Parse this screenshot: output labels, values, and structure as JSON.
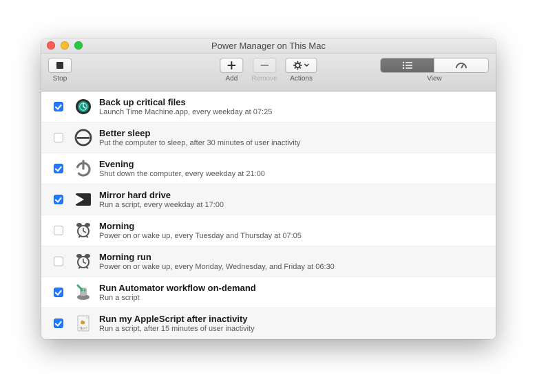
{
  "window": {
    "title": "Power Manager on This Mac"
  },
  "toolbar": {
    "stop": "Stop",
    "add": "Add",
    "remove": "Remove",
    "actions": "Actions",
    "view": "View"
  },
  "events": [
    {
      "checked": true,
      "icon": "timemachine",
      "title": "Back up critical files",
      "subtitle": "Launch Time Machine.app, every weekday at 07:25"
    },
    {
      "checked": false,
      "icon": "sleep",
      "title": "Better sleep",
      "subtitle": "Put the computer to sleep, after 30 minutes of user inactivity"
    },
    {
      "checked": true,
      "icon": "power",
      "title": "Evening",
      "subtitle": "Shut down the computer, every weekday at 21:00"
    },
    {
      "checked": true,
      "icon": "script",
      "title": "Mirror hard drive",
      "subtitle": "Run a script, every weekday at 17:00"
    },
    {
      "checked": false,
      "icon": "alarm",
      "title": "Morning",
      "subtitle": "Power on or wake up, every Tuesday and Thursday at 07:05"
    },
    {
      "checked": false,
      "icon": "alarm",
      "title": "Morning run",
      "subtitle": "Power on or wake up, every Monday, Wednesday, and Friday at 06:30"
    },
    {
      "checked": true,
      "icon": "automator",
      "title": "Run Automator workflow on-demand",
      "subtitle": "Run a script"
    },
    {
      "checked": true,
      "icon": "applescript",
      "title": "Run my AppleScript after inactivity",
      "subtitle": "Run a script, after 15 minutes of user inactivity"
    }
  ]
}
